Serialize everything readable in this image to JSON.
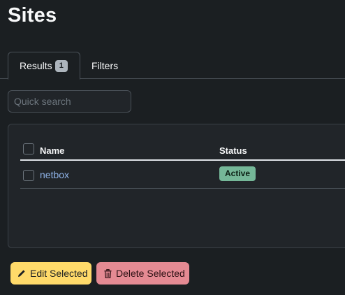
{
  "page": {
    "title": "Sites"
  },
  "tabs": [
    {
      "label": "Results",
      "count": "1"
    },
    {
      "label": "Filters"
    }
  ],
  "search": {
    "placeholder": "Quick search"
  },
  "table": {
    "columns": [
      "Name",
      "Status"
    ],
    "rows": [
      {
        "name": "netbox",
        "status": "Active"
      }
    ]
  },
  "colors": {
    "status_active": "#75b798",
    "link": "#8fb3e8",
    "edit": "#ffda6a",
    "delete": "#e48a93"
  },
  "actions": {
    "edit_label": "Edit Selected",
    "edit_icon": "pencil-icon",
    "delete_label": "Delete Selected",
    "delete_icon": "trash-icon"
  }
}
